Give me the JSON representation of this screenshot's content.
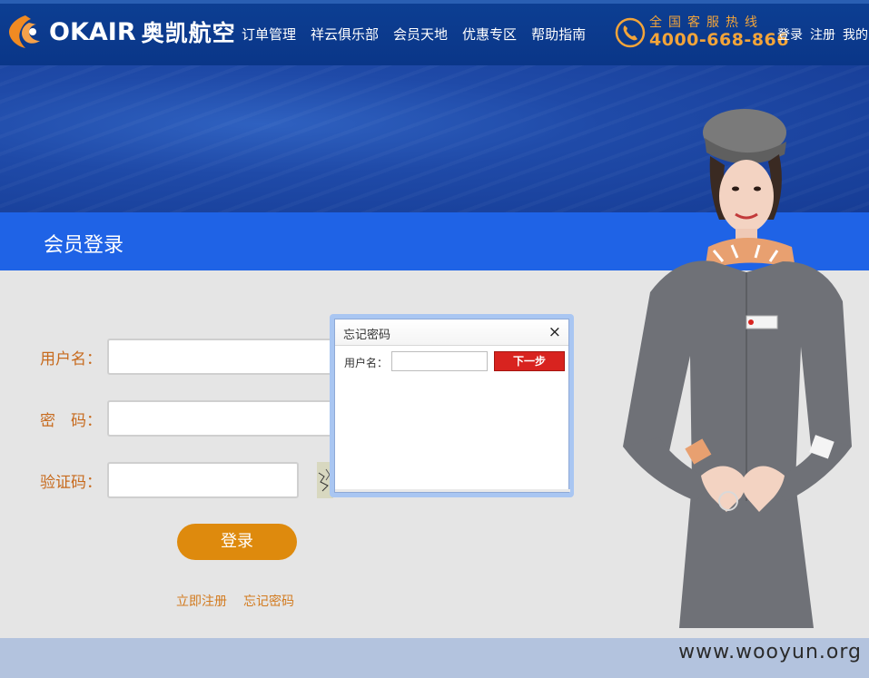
{
  "header": {
    "logo_text": "OKAIR",
    "logo_cn": "奥凯航空",
    "nav": [
      "订单管理",
      "祥云俱乐部",
      "会员天地",
      "优惠专区",
      "帮助指南"
    ],
    "hotline_label": "全国客服热线",
    "hotline_number": "4000-668-866",
    "user_links": [
      "登录",
      "注册",
      "我的"
    ]
  },
  "page": {
    "title": "会员登录"
  },
  "form": {
    "username_label": "用户名：",
    "password_label": "密　码：",
    "captcha_label": "验证码：",
    "username_value": "",
    "password_value": "",
    "captcha_value": "",
    "login_button": "登录",
    "register_link": "立即注册",
    "forgot_link": "忘记密码"
  },
  "dialog": {
    "title": "忘记密码",
    "close": "×",
    "username_label": "用户名：",
    "username_value": "",
    "next_button": "下一步"
  },
  "watermark": "www.wooyun.org",
  "colors": {
    "header_bg": "#0a3688",
    "title_bar": "#1f63e6",
    "accent_orange": "#de8a0d",
    "label_orange": "#c76a1d",
    "next_button_red": "#d8231f"
  }
}
